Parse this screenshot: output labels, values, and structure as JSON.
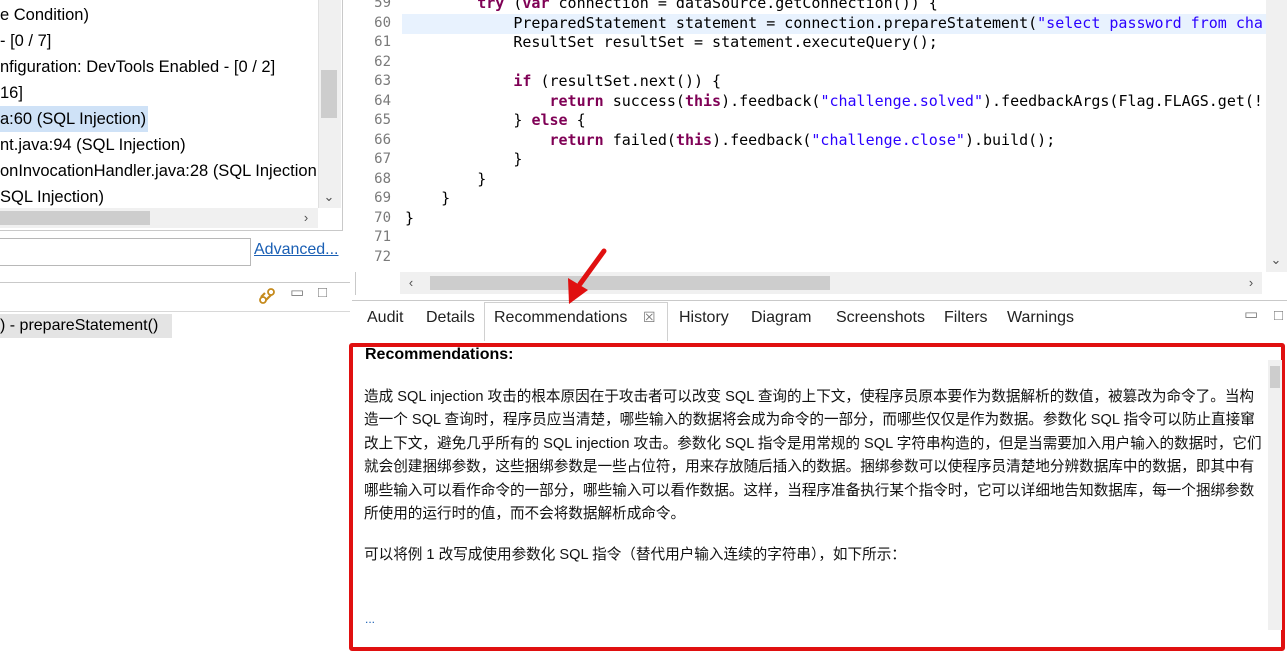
{
  "tree": {
    "items": [
      {
        "label": "e Condition)",
        "selected": false
      },
      {
        "label": "- [0 / 7]",
        "selected": false
      },
      {
        "label": "nfiguration: DevTools Enabled - [0 / 2]",
        "selected": false
      },
      {
        "label": "16]",
        "selected": false
      },
      {
        "label": "a:60 (SQL Injection)",
        "selected": true
      },
      {
        "label": "nt.java:94 (SQL Injection)",
        "selected": false
      },
      {
        "label": "onInvocationHandler.java:28 (SQL Injection",
        "selected": false
      },
      {
        "label": "SQL Injection)",
        "selected": false
      }
    ]
  },
  "search": {
    "value": "",
    "advanced_label": "Advanced..."
  },
  "trace": {
    "label": ") - prepareStatement()"
  },
  "editor": {
    "line_numbers": [
      "59",
      "60",
      "61",
      "62",
      "63",
      "64",
      "65",
      "66",
      "67",
      "68",
      "69",
      "70",
      "71",
      "72"
    ],
    "highlighted_line": "60"
  },
  "tabs": [
    "Audit",
    "Details",
    "Recommendations",
    "History",
    "Diagram",
    "Screenshots",
    "Filters",
    "Warnings"
  ],
  "active_tab": "Recommendations",
  "recommendations": {
    "title": "Recommendations:",
    "paragraph": "造成 SQL injection 攻击的根本原因在于攻击者可以改变 SQL 查询的上下文，使程序员原本要作为数据解析的数值，被篡改为命令了。当构造一个 SQL 查询时，程序员应当清楚，哪些输入的数据将会成为命令的一部分，而哪些仅仅是作为数据。参数化 SQL 指令可以防止直接窜改上下文，避免几乎所有的 SQL injection 攻击。参数化 SQL 指令是用常规的 SQL 字符串构造的，但是当需要加入用户输入的数据时，它们就会创建捆绑参数，这些捆绑参数是一些占位符，用来存放随后插入的数据。捆绑参数可以使程序员清楚地分辨数据库中的数据，即其中有哪些输入可以看作命令的一部分，哪些输入可以看作数据。这样，当程序准备执行某个指令时，它可以详细地告知数据库，每一个捆绑参数所使用的运行时的值，而不会将数据解析成命令。",
    "note": "可以将例 1 改写成使用参数化 SQL 指令（替代用户输入连续的字符串），如下所示：",
    "ellipsis": "..."
  },
  "colors": {
    "highlight_border": "#e01010",
    "selection": "#cfe2f7",
    "keyword": "#7f0055",
    "string": "#2a00ff"
  }
}
